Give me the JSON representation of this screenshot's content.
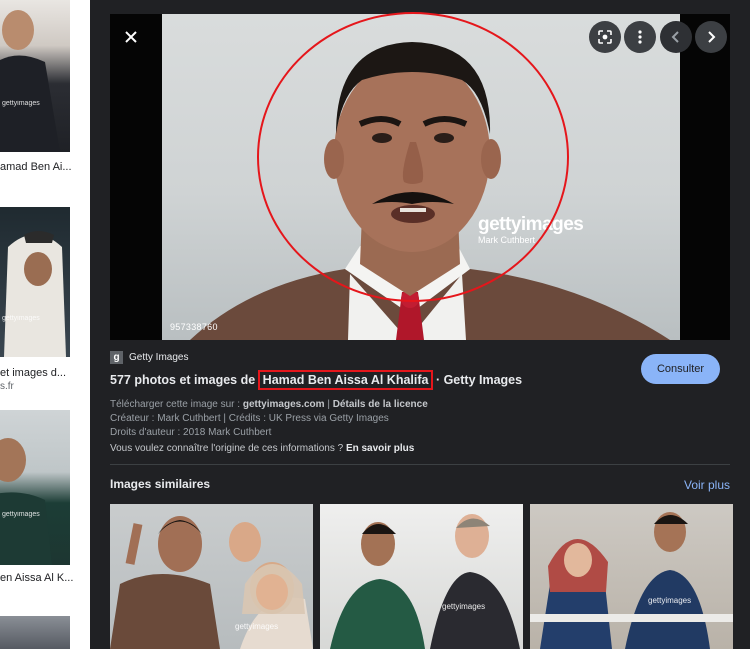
{
  "left_results": {
    "items": [
      {
        "caption": "amad Ben Ai...",
        "source": ""
      },
      {
        "caption": "et images d...",
        "source": "s.fr"
      },
      {
        "caption": "en Aissa Al K...",
        "source": ""
      }
    ],
    "watermark": "gettyimages"
  },
  "viewer": {
    "icons": {
      "close": "close-icon",
      "lens": "lens-icon",
      "more": "more-vert-icon",
      "prev": "chevron-left-icon",
      "next": "chevron-right-icon"
    },
    "photo": {
      "watermark_brand": "gettyimages",
      "watermark_author": "Mark Cuthbert",
      "image_id": "957338760"
    },
    "source_name": "Getty Images",
    "source_logo_letter": "g",
    "title_before": "577 photos et images de ",
    "title_highlight": "Hamad Ben Aissa Al Khalifa",
    "title_after": " · Getty Images",
    "consult_label": "Consulter",
    "meta": {
      "download_prefix": "Télécharger cette image sur : ",
      "download_site": "gettyimages.com",
      "download_sep": " | ",
      "license_link": "Détails de la licence",
      "creator_line": "Créateur : Mark Cuthbert | Crédits : UK Press via Getty Images",
      "copyright_line": "Droits d'auteur : 2018 Mark Cuthbert",
      "origin_question": "Vous voulez connaître l'origine de ces informations ? ",
      "learn_more": "En savoir plus"
    },
    "similar_title": "Images similaires",
    "see_more": "Voir plus",
    "similar_watermarks": [
      "gettyimages",
      "gettyimages",
      "gettyimages"
    ]
  },
  "colors": {
    "panel_bg": "#202124",
    "accent_blue": "#8ab4f8",
    "annotation_red": "#e5161b"
  }
}
